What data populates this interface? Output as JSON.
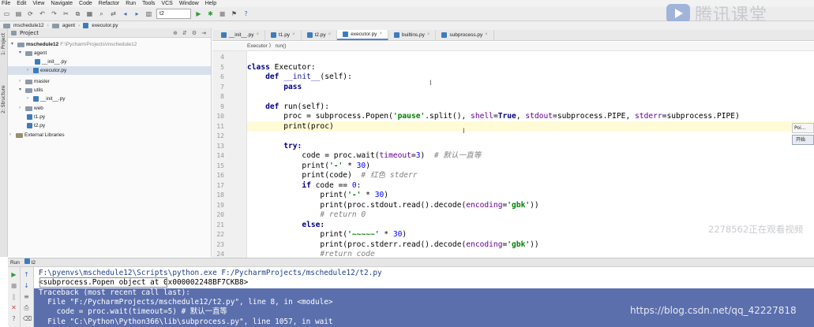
{
  "menu": [
    "File",
    "Edit",
    "View",
    "Navigate",
    "Code",
    "Refactor",
    "Run",
    "Tools",
    "VCS",
    "Window",
    "Help"
  ],
  "toolbar": {
    "run_config": "t2"
  },
  "watermark_logo": "腾讯课堂",
  "project_panel": {
    "header": "Project",
    "tree": [
      {
        "label": "mschedule12",
        "extra": "F:\\PycharmProjects\\mschedule12",
        "kind": "folder",
        "bold": true
      },
      {
        "label": "agent",
        "kind": "folder"
      },
      {
        "label": "__init__.py",
        "kind": "py"
      },
      {
        "label": "executor.py",
        "kind": "py"
      },
      {
        "label": "master",
        "kind": "folder"
      },
      {
        "label": "utils",
        "kind": "folder"
      },
      {
        "label": "__init__.py",
        "kind": "py"
      },
      {
        "label": "web",
        "kind": "folder"
      },
      {
        "label": "t1.py",
        "kind": "py"
      },
      {
        "label": "t2.py",
        "kind": "py"
      },
      {
        "label": "External Libraries",
        "kind": "lib"
      }
    ]
  },
  "side_strip": {
    "project": "1: Project",
    "structure": "2: Structure"
  },
  "nav_breadcrumb": [
    "mschedule12",
    "agent",
    "executor.py"
  ],
  "editor_tabs": [
    "__init__.py",
    "t1.py",
    "t2.py",
    "executor.py",
    "builtins.py",
    "subprocess.py"
  ],
  "editor_breadcrumb": "Executor  〉 run()",
  "line_numbers": [
    "4",
    "5",
    "6",
    "7",
    "8",
    "9",
    "10",
    "11",
    "12",
    "13",
    "14",
    "15",
    "16",
    "17",
    "18",
    "19",
    "20",
    "21",
    "22",
    "23",
    "24"
  ],
  "code": {
    "l5_kw": "class",
    "l5_rest": " Executor:",
    "l6_kw": "def",
    "l6_fn": " __init__",
    "l6_rest": "(self):",
    "l7_kw": "pass",
    "l9_kw": "def",
    "l9_rest": " run(self):",
    "l10_a": "proc = subprocess.Popen(",
    "l10_str": "'pause'",
    "l10_b": ".split(), ",
    "l10_p1": "shell",
    "l10_c": "=",
    "l10_true": "True",
    "l10_d": ", ",
    "l10_p2": "stdout",
    "l10_e": "=subprocess.PIPE, ",
    "l10_p3": "stderr",
    "l10_f": "=subprocess.PIPE)",
    "l11": "print(proc)",
    "l13_kw": "try:",
    "l14_a": "code = proc.wait(",
    "l14_p": "timeout",
    "l14_b": "=",
    "l14_num": "3",
    "l14_c": ")  ",
    "l14_cm": "# 默认一直等",
    "l15_a": "print(",
    "l15_str": "'-'",
    "l15_b": " * ",
    "l15_num": "30",
    "l15_c": ")",
    "l16_a": "print(code)  ",
    "l16_cm": "# 红色 stderr",
    "l17_kw": "if",
    "l17_a": " code == ",
    "l17_num": "0",
    "l17_b": ":",
    "l18_a": "print(",
    "l18_str": "'-'",
    "l18_b": " * ",
    "l18_num": "30",
    "l18_c": ")",
    "l19_a": "print(proc.stdout.read().decode(",
    "l19_p": "encoding",
    "l19_b": "=",
    "l19_str": "'gbk'",
    "l19_c": "))",
    "l20_cm": "# return 0",
    "l21_kw": "else:",
    "l22_a": "print(",
    "l22_str": "'~~~~~'",
    "l22_b": " * ",
    "l22_num": "30",
    "l22_c": ")",
    "l23_a": "print(proc.stderr.read().decode(",
    "l23_p": "encoding",
    "l23_b": "=",
    "l23_str": "'gbk'",
    "l23_c": "))",
    "l24_cm": "#return code"
  },
  "popups": {
    "first": "Poi...",
    "second": "开始"
  },
  "run_panel": {
    "header": "Run",
    "config": "t2",
    "lines": [
      "F:\\pyenvs\\mschedule12\\Scripts\\python.exe F:/PycharmProjects/mschedule12/t2.py",
      "<subprocess.Popen object at 0x000002248BF7CKB8>",
      "Traceback (most recent call last):",
      "  File \"F:/PycharmProjects/mschedule12/t2.py\", line 8, in <module>",
      "    code = proc.wait(timeout=5) # 默认一直等",
      "  File \"C:\\Python\\Python366\\lib\\subprocess.py\", line 1057, in wait"
    ]
  },
  "watermarks": {
    "viewer": "2278562正在观看视频",
    "blog": "https://blog.csdn.net/qq_42227818"
  }
}
